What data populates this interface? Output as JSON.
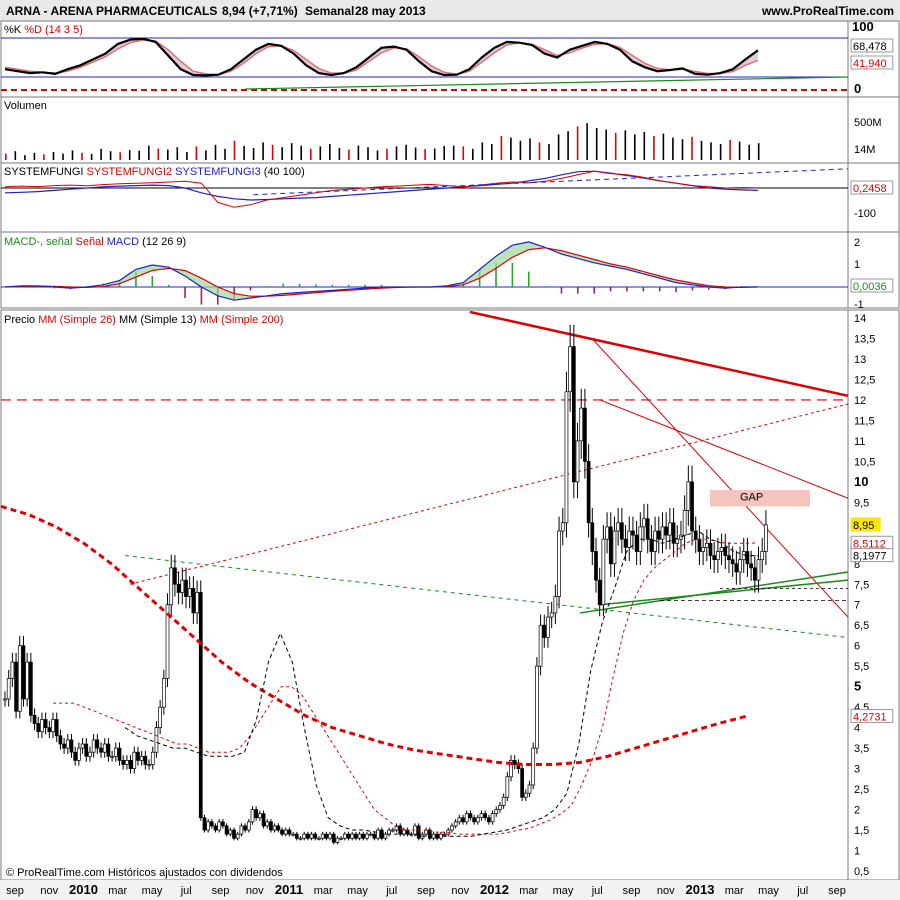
{
  "header": {
    "symbol": "ARNA - ARENA PHARMACEUTICALS",
    "last": "8,94 (+7,71%)",
    "period": "Semanal",
    "date": "28 may 2013",
    "site": "www.ProRealTime.com"
  },
  "footer": {
    "credit": "© ProRealTime.com  Históricos ajustados con dividendos"
  },
  "colors": {
    "red": "#e00000",
    "blue": "#2020d0",
    "green": "#1a8a1a",
    "gapfill": "#f6c4bf",
    "candle_up": "#ffffff",
    "candle_down": "#000000"
  },
  "x_axis": {
    "ticks": [
      {
        "label": "sep",
        "bold": false
      },
      {
        "label": "nov",
        "bold": false
      },
      {
        "label": "2010",
        "bold": true
      },
      {
        "label": "mar",
        "bold": false
      },
      {
        "label": "may",
        "bold": false
      },
      {
        "label": "jul",
        "bold": false
      },
      {
        "label": "sep",
        "bold": false
      },
      {
        "label": "nov",
        "bold": false
      },
      {
        "label": "2011",
        "bold": true
      },
      {
        "label": "mar",
        "bold": false
      },
      {
        "label": "may",
        "bold": false
      },
      {
        "label": "jul",
        "bold": false
      },
      {
        "label": "sep",
        "bold": false
      },
      {
        "label": "nov",
        "bold": false
      },
      {
        "label": "2012",
        "bold": true
      },
      {
        "label": "mar",
        "bold": false
      },
      {
        "label": "may",
        "bold": false
      },
      {
        "label": "jul",
        "bold": false
      },
      {
        "label": "sep",
        "bold": false
      },
      {
        "label": "nov",
        "bold": false
      },
      {
        "label": "2013",
        "bold": true
      },
      {
        "label": "mar",
        "bold": false
      },
      {
        "label": "may",
        "bold": false
      },
      {
        "label": "jul",
        "bold": false
      },
      {
        "label": "sep",
        "bold": false
      }
    ]
  },
  "panels": {
    "stoch": {
      "title_parts": [
        {
          "text": "%K ",
          "color": "#000000"
        },
        {
          "text": "%D",
          "color": "#e00000"
        },
        {
          "text": " (14 3 5)",
          "color": "#e00000"
        }
      ],
      "ticks": [
        "100",
        "0"
      ],
      "k_value": "68,478",
      "d_value": "41,940"
    },
    "volume": {
      "title": "Volumen",
      "ticks": [
        "500M",
        "14M"
      ]
    },
    "fungi": {
      "title_parts": [
        {
          "text": "SYSTEMFUNGI ",
          "color": "#000000"
        },
        {
          "text": "SYSTEMFUNGI2 ",
          "color": "#e00000"
        },
        {
          "text": "SYSTEMFUNGI3",
          "color": "#2020d0"
        },
        {
          "text": " (40 100)",
          "color": "#000000"
        }
      ],
      "ticks": [
        "0",
        "-100"
      ],
      "value": "0,2458"
    },
    "macd": {
      "title_parts": [
        {
          "text": "MACD-, señal ",
          "color": "#1a8a1a"
        },
        {
          "text": "Señal ",
          "color": "#e00000"
        },
        {
          "text": "MACD",
          "color": "#2020d0"
        },
        {
          "text": " (12 26 9)",
          "color": "#000000"
        }
      ],
      "ticks": [
        "2",
        "1",
        "-1"
      ],
      "value": "0,0036"
    },
    "price": {
      "title_parts": [
        {
          "text": "Precio ",
          "color": "#000000"
        },
        {
          "text": "MM (Simple 26) ",
          "color": "#e00000"
        },
        {
          "text": "MM (Simple 13) ",
          "color": "#000000"
        },
        {
          "text": "MM (Simple 200)",
          "color": "#e00000"
        }
      ],
      "gap_label": "GAP",
      "value_tags": [
        {
          "text": "8,95",
          "kind": "last"
        },
        {
          "text": "8,5112",
          "kind": "sma26"
        },
        {
          "text": "8,1977",
          "kind": "sma13"
        },
        {
          "text": "4,2731",
          "kind": "sma200"
        }
      ]
    }
  },
  "chart_data": [
    {
      "type": "line",
      "title": "%K %D (14 3 5)",
      "ylim": [
        0,
        100
      ],
      "series": [
        {
          "name": "%K",
          "values": [
            20,
            15,
            10,
            12,
            8,
            20,
            30,
            45,
            60,
            85,
            96,
            98,
            90,
            55,
            20,
            5,
            4,
            6,
            20,
            45,
            70,
            85,
            80,
            60,
            30,
            10,
            5,
            10,
            25,
            50,
            75,
            78,
            70,
            40,
            15,
            5,
            6,
            20,
            50,
            75,
            90,
            88,
            82,
            60,
            50,
            70,
            80,
            90,
            85,
            70,
            40,
            25,
            15,
            18,
            22,
            8,
            6,
            10,
            20,
            45,
            68.478
          ]
        },
        {
          "name": "%D",
          "values": [
            25,
            20,
            15,
            12,
            10,
            15,
            25,
            38,
            52,
            72,
            88,
            95,
            92,
            70,
            40,
            15,
            8,
            6,
            15,
            35,
            60,
            78,
            80,
            68,
            45,
            22,
            10,
            10,
            18,
            40,
            62,
            75,
            72,
            52,
            28,
            12,
            7,
            15,
            38,
            62,
            82,
            88,
            84,
            70,
            55,
            62,
            74,
            84,
            86,
            76,
            55,
            35,
            22,
            18,
            20,
            14,
            9,
            9,
            14,
            30,
            41.94
          ]
        }
      ]
    },
    {
      "type": "bar",
      "title": "Volumen",
      "series": [
        {
          "name": "Volumen",
          "values": [
            40,
            55,
            30,
            45,
            35,
            50,
            40,
            60,
            45,
            38,
            70,
            55,
            48,
            62,
            58,
            90,
            72,
            65,
            80,
            50,
            85,
            60,
            95,
            70,
            120,
            88,
            75,
            110,
            95,
            80,
            105,
            90,
            70,
            85,
            100,
            75,
            65,
            90,
            80,
            60,
            70,
            85,
            95,
            78,
            68,
            72,
            88,
            90,
            85,
            70,
            110,
            100,
            150,
            140,
            120,
            135,
            110,
            100,
            160,
            180,
            210,
            230,
            200,
            190,
            170,
            185,
            160,
            175,
            150,
            165,
            140,
            130,
            145,
            120,
            110,
            100,
            125,
            115,
            95,
            105
          ]
        }
      ]
    },
    {
      "type": "line",
      "title": "SYSTEMFUNGI SYSTEMFUNGI2 SYSTEMFUNGI3 (40 100)",
      "series": [
        {
          "name": "SYSTEMFUNGI2",
          "values": [
            5,
            8,
            6,
            10,
            12,
            9,
            14,
            18,
            20,
            22,
            25,
            28,
            20,
            -60,
            -80,
            -70,
            -50,
            -40,
            -30,
            -20,
            -10,
            -5,
            0,
            5,
            8,
            12,
            15,
            10,
            5,
            12,
            20,
            25,
            22,
            28,
            40,
            55,
            70,
            60,
            55,
            45,
            30,
            20,
            10,
            5,
            0,
            2,
            0.2458
          ]
        },
        {
          "name": "SYSTEMFUNGI3",
          "values": [
            -20,
            -18,
            -15,
            -10,
            -5,
            0,
            5,
            8,
            10,
            12,
            10,
            0,
            -20,
            -35,
            -45,
            -50,
            -48,
            -45,
            -42,
            -40,
            -35,
            -30,
            -25,
            -20,
            -15,
            -10,
            -5,
            0,
            5,
            10,
            15,
            20,
            30,
            40,
            55,
            68,
            70,
            62,
            52,
            42,
            30,
            20,
            10,
            0,
            -5,
            -8,
            -10
          ]
        }
      ]
    },
    {
      "type": "line",
      "title": "MACD-, señal Señal MACD (12 26 9)",
      "ylim": [
        -1.5,
        2.5
      ],
      "series": [
        {
          "name": "MACD",
          "values": [
            0.0,
            0.05,
            0.05,
            0.0,
            -0.05,
            0.0,
            0.1,
            0.3,
            0.8,
            1.0,
            0.9,
            0.5,
            0.0,
            -0.4,
            -0.6,
            -0.5,
            -0.4,
            -0.3,
            -0.25,
            -0.2,
            -0.15,
            -0.1,
            -0.05,
            0.0,
            0.0,
            0.0,
            0.0,
            0.05,
            0.2,
            0.8,
            1.4,
            1.9,
            2.05,
            1.8,
            1.5,
            1.3,
            1.1,
            0.95,
            0.8,
            0.6,
            0.4,
            0.2,
            0.1,
            0.0,
            -0.05,
            0.0,
            0.0036
          ]
        },
        {
          "name": "Señal",
          "values": [
            0.0,
            0.02,
            0.04,
            0.03,
            0.0,
            -0.02,
            0.02,
            0.15,
            0.45,
            0.75,
            0.85,
            0.75,
            0.4,
            0.0,
            -0.3,
            -0.42,
            -0.42,
            -0.38,
            -0.32,
            -0.26,
            -0.2,
            -0.15,
            -0.1,
            -0.05,
            -0.02,
            0.0,
            0.0,
            0.02,
            0.1,
            0.4,
            0.85,
            1.35,
            1.7,
            1.78,
            1.65,
            1.45,
            1.25,
            1.05,
            0.9,
            0.7,
            0.5,
            0.32,
            0.18,
            0.06,
            0.0,
            -0.02,
            0.0
          ]
        }
      ]
    },
    {
      "type": "line",
      "title": "Precio MM (Simple 26) MM (Simple 13) MM (Simple 200)",
      "y_ticks": [
        14,
        13.5,
        13,
        12.5,
        12,
        11.5,
        11,
        10.5,
        10,
        9.5,
        9,
        8.5,
        8,
        7.5,
        7,
        6.5,
        6,
        5.5,
        5,
        4.5,
        4,
        3.5,
        3,
        2.5,
        2,
        1.5,
        1,
        0.5
      ],
      "y_tick_labels": [
        "14",
        "13,5",
        "13",
        "12,5",
        "12",
        "11,5",
        "11",
        "10,5",
        "10",
        "9,5",
        "9",
        "8,5",
        "8",
        "7,5",
        "7",
        "6,5",
        "6",
        "5,5",
        "5",
        "4,5",
        "4",
        "3,5",
        "3",
        "2,5",
        "2",
        "1,5",
        "1",
        "0,5"
      ],
      "y_tick_bold": [
        "10",
        "5"
      ],
      "ylim": [
        0.4,
        14.2
      ],
      "x_range_weeks": [
        0,
        210
      ],
      "series": [
        {
          "name": "Precio",
          "values": [
            4.7,
            5.2,
            5.6,
            4.4,
            6.0,
            4.7,
            5.6,
            4.3,
            4.1,
            3.9,
            4.2,
            4.0,
            3.9,
            4.2,
            3.8,
            3.6,
            3.5,
            3.7,
            3.4,
            3.2,
            3.5,
            3.6,
            3.3,
            3.4,
            3.7,
            3.5,
            3.4,
            3.6,
            3.3,
            3.3,
            3.5,
            3.2,
            3.1,
            3.2,
            3.0,
            3.4,
            3.2,
            3.3,
            3.1,
            3.1,
            3.4,
            4.0,
            4.5,
            5.2,
            7.0,
            7.9,
            7.5,
            7.3,
            7.6,
            7.2,
            7.4,
            6.8,
            7.3,
            1.8,
            1.5,
            1.7,
            1.6,
            1.5,
            1.7,
            1.6,
            1.4,
            1.5,
            1.3,
            1.4,
            1.6,
            1.5,
            1.7,
            2.0,
            1.8,
            1.9,
            1.6,
            1.7,
            1.5,
            1.6,
            1.5,
            1.4,
            1.5,
            1.4,
            1.4,
            1.3,
            1.3,
            1.4,
            1.3,
            1.4,
            1.3,
            1.3,
            1.4,
            1.3,
            1.4,
            1.2,
            1.3,
            1.3,
            1.4,
            1.3,
            1.4,
            1.3,
            1.4,
            1.3,
            1.4,
            1.4,
            1.3,
            1.5,
            1.3,
            1.4,
            1.5,
            1.5,
            1.6,
            1.4,
            1.5,
            1.4,
            1.4,
            1.6,
            1.3,
            1.4,
            1.5,
            1.3,
            1.4,
            1.3,
            1.4,
            1.4,
            1.5,
            1.6,
            1.7,
            1.8,
            1.7,
            1.9,
            1.8,
            1.7,
            1.8,
            1.9,
            1.8,
            1.7,
            1.9,
            2.0,
            2.1,
            2.3,
            2.8,
            3.2,
            3.1,
            3.0,
            2.3,
            2.4,
            2.6,
            3.5,
            5.5,
            6.5,
            6.2,
            6.7,
            6.8,
            7.2,
            8.8,
            9.0,
            12.2,
            13.3,
            10.0,
            11.0,
            11.8,
            10.5,
            9.0,
            8.3,
            7.6,
            7.0,
            8.6,
            8.9,
            8.0,
            8.8,
            9.0,
            8.6,
            8.4,
            8.8,
            8.7,
            8.3,
            8.9,
            9.1,
            8.6,
            8.3,
            8.8,
            8.6,
            8.9,
            8.7,
            9.0,
            8.5,
            8.6,
            8.7,
            9.3,
            10.0,
            8.8,
            8.6,
            8.3,
            8.4,
            8.5,
            8.2,
            8.1,
            8.3,
            8.4,
            8.2,
            8.1,
            8.0,
            7.8,
            8.1,
            8.3,
            8.0,
            7.9,
            7.6,
            8.1,
            8.3,
            8.95
          ]
        },
        {
          "name": "MM (Simple 26)",
          "values": [
            4.6,
            4.6,
            4.6,
            4.5,
            4.4,
            4.3,
            4.2,
            4.1,
            4.0,
            3.9,
            3.8,
            3.7,
            3.6,
            3.6,
            3.5,
            3.4,
            3.4,
            3.4,
            3.5,
            3.8,
            4.2,
            4.6,
            5.0,
            5.0,
            4.8,
            4.4,
            4.0,
            3.6,
            3.2,
            2.8,
            2.4,
            2.0,
            1.8,
            1.6,
            1.5,
            1.5,
            1.5,
            1.45,
            1.45,
            1.4,
            1.4,
            1.4,
            1.4,
            1.4,
            1.45,
            1.5,
            1.55,
            1.65,
            1.75,
            1.9,
            2.1,
            2.6,
            3.2,
            4.0,
            5.2,
            6.3,
            7.1,
            7.6,
            7.9,
            8.1,
            8.3,
            8.5,
            8.6,
            8.6,
            8.55,
            8.5,
            8.5,
            8.5,
            8.5112
          ]
        },
        {
          "name": "MM (Simple 13)",
          "values": [
            4.0,
            3.8,
            3.7,
            3.6,
            3.5,
            3.5,
            3.4,
            3.3,
            3.3,
            3.3,
            3.4,
            4.2,
            5.6,
            6.3,
            5.6,
            4.0,
            2.6,
            1.8,
            1.6,
            1.5,
            1.5,
            1.45,
            1.4,
            1.4,
            1.4,
            1.35,
            1.35,
            1.35,
            1.35,
            1.35,
            1.4,
            1.45,
            1.5,
            1.6,
            1.7,
            1.8,
            2.0,
            2.4,
            3.6,
            5.4,
            6.6,
            7.4,
            8.3,
            8.6,
            8.6,
            8.5,
            8.6,
            8.7,
            8.8,
            8.6,
            8.5,
            8.3,
            8.2,
            8.1977
          ]
        },
        {
          "name": "MM (Simple 200)",
          "values": [
            9.4,
            9.2,
            8.9,
            8.5,
            8.0,
            7.4,
            6.8,
            6.2,
            5.6,
            5.1,
            4.7,
            4.3,
            4.0,
            3.8,
            3.6,
            3.45,
            3.35,
            3.25,
            3.15,
            3.1,
            3.1,
            3.15,
            3.3,
            3.5,
            3.7,
            3.9,
            4.1,
            4.2731
          ]
        }
      ],
      "annotations": [
        "GAP"
      ]
    }
  ]
}
